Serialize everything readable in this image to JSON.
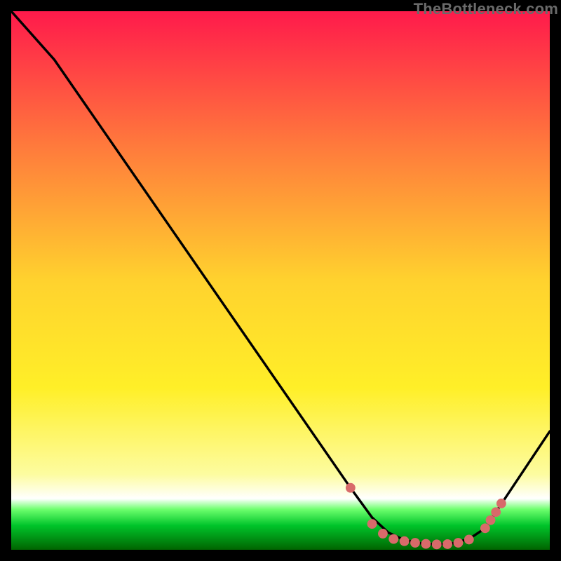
{
  "watermark": "TheBottleneck.com",
  "colors": {
    "background": "#000000",
    "gradient_stops": [
      {
        "offset": 0.0,
        "color": "#ff1a4b"
      },
      {
        "offset": 0.25,
        "color": "#ff7a3c"
      },
      {
        "offset": 0.5,
        "color": "#ffd22e"
      },
      {
        "offset": 0.7,
        "color": "#ffef28"
      },
      {
        "offset": 0.86,
        "color": "#fdfca0"
      },
      {
        "offset": 0.905,
        "color": "#ffffff"
      },
      {
        "offset": 0.925,
        "color": "#6dff6d"
      },
      {
        "offset": 0.955,
        "color": "#00c42a"
      },
      {
        "offset": 1.0,
        "color": "#006400"
      }
    ],
    "line": "#000000",
    "marker": "#d86a6a"
  },
  "chart_data": {
    "type": "line",
    "xlim": [
      0,
      100
    ],
    "ylim": [
      0,
      100
    ],
    "series": [
      {
        "name": "curve",
        "x": [
          0,
          8,
          63,
          67,
          70,
          73,
          76,
          79,
          82,
          85,
          88,
          100
        ],
        "y": [
          100,
          91,
          11.5,
          6,
          3.2,
          1.8,
          1.2,
          1.0,
          1.2,
          2.0,
          4.0,
          22
        ]
      }
    ],
    "markers": {
      "x": [
        63,
        67,
        69,
        71,
        73,
        75,
        77,
        79,
        81,
        83,
        85,
        88,
        89,
        90,
        91
      ],
      "y": [
        11.5,
        4.8,
        3.0,
        2.0,
        1.6,
        1.3,
        1.1,
        1.0,
        1.05,
        1.3,
        1.9,
        4.0,
        5.5,
        7.0,
        8.6
      ]
    }
  }
}
